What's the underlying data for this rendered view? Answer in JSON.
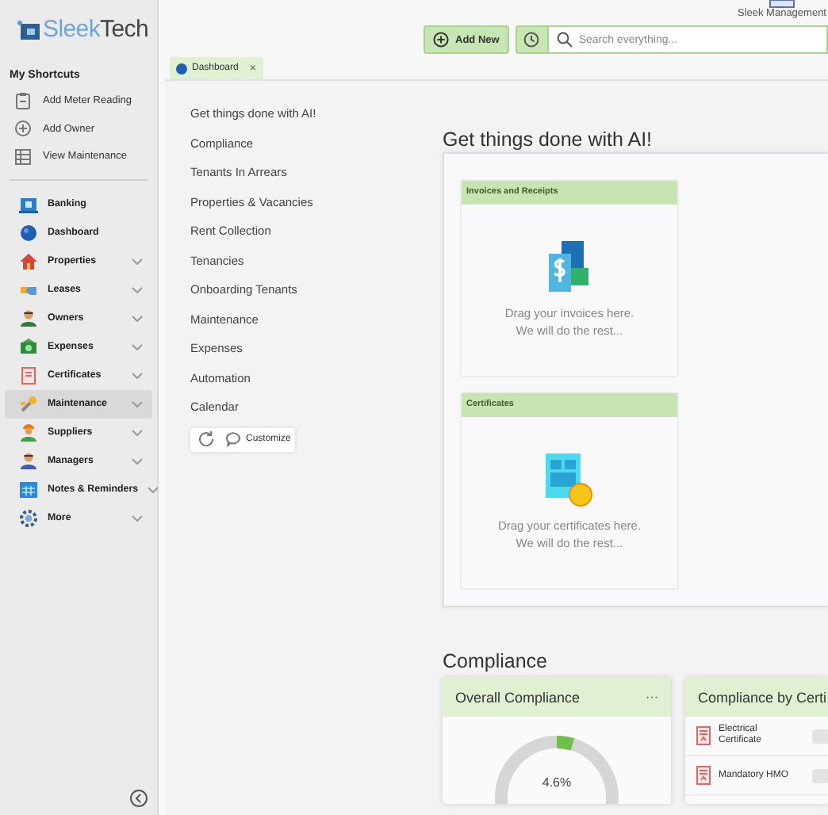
{
  "logo": {
    "first": "Sleek",
    "second": "Tech"
  },
  "shortcuts": {
    "title": "My Shortcuts",
    "items": [
      "Add Meter Reading",
      "Add Owner",
      "View Maintenance"
    ]
  },
  "nav": [
    {
      "label": "Banking",
      "expandable": false,
      "selected": false
    },
    {
      "label": "Dashboard",
      "expandable": false,
      "selected": false
    },
    {
      "label": "Properties",
      "expandable": true,
      "selected": false
    },
    {
      "label": "Leases",
      "expandable": true,
      "selected": false
    },
    {
      "label": "Owners",
      "expandable": true,
      "selected": false
    },
    {
      "label": "Expenses",
      "expandable": true,
      "selected": false
    },
    {
      "label": "Certificates",
      "expandable": true,
      "selected": false
    },
    {
      "label": "Maintenance",
      "expandable": true,
      "selected": true
    },
    {
      "label": "Suppliers",
      "expandable": true,
      "selected": false
    },
    {
      "label": "Managers",
      "expandable": true,
      "selected": false
    },
    {
      "label": "Notes & Reminders",
      "expandable": true,
      "selected": false
    },
    {
      "label": "More",
      "expandable": true,
      "selected": false
    }
  ],
  "topbar": {
    "app_name": "Sleek Management",
    "add_button": "Add New",
    "search": {
      "placeholder": "Search everything..."
    }
  },
  "tabs": [
    {
      "label": "Dashboard",
      "selected": true,
      "close": "×"
    }
  ],
  "sections": [
    "Get things done with AI!",
    "Compliance",
    "Tenants In Arrears",
    "Properties & Vacancies",
    "Rent Collection",
    "Tenancies",
    "Onboarding Tenants",
    "Maintenance",
    "Expenses",
    "Automation",
    "Calendar"
  ],
  "customize_button": "Customize",
  "ai": {
    "heading": "Get things done with AI!",
    "cards": [
      {
        "kind": "invoice",
        "title": "Invoices and Receipts",
        "lines": [
          "Drag your invoices here.",
          "We will do the rest..."
        ]
      },
      {
        "kind": "certificate",
        "title": "Certificates",
        "lines": [
          "Drag your certificates here.",
          "We will do the rest..."
        ]
      }
    ]
  },
  "compliance": {
    "heading": "Compliance",
    "overall": {
      "title": "Overall Compliance",
      "menu": "···",
      "level": 0.046,
      "reading": "4.6%"
    },
    "by_certificate": {
      "title": "Compliance by Certi",
      "rows": [
        "Electrical Certificate",
        "Mandatory HMO"
      ]
    }
  }
}
